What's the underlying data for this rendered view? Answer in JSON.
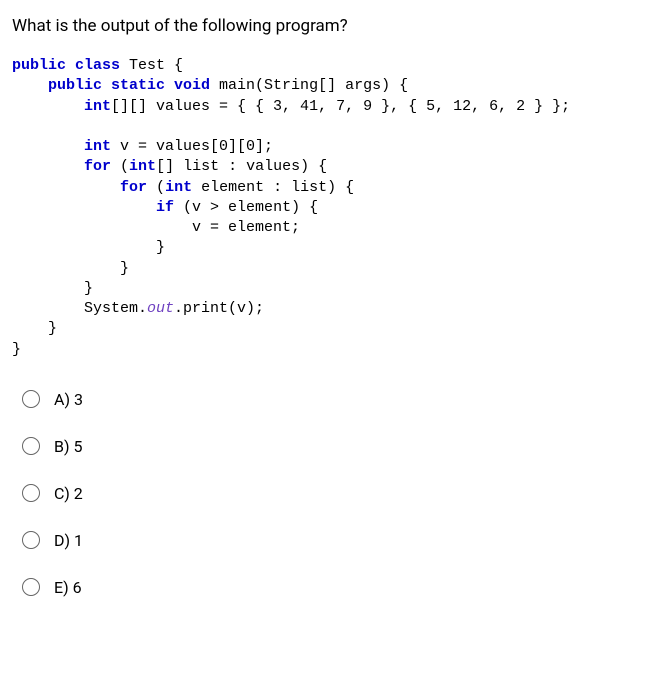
{
  "question": "What is the output of the following program?",
  "code": {
    "l1_kw1": "public class",
    "l1_cls": " Test {",
    "l2_kw1": "public static void",
    "l2_m": " main(String[] args) {",
    "l3_kw1": "int",
    "l3_rest": "[][] values = { { 3, 41, 7, 9 }, { 5, 12, 6, 2 } };",
    "l4_kw1": "int",
    "l4_rest": " v = values[0][0];",
    "l5_kw1": "for",
    "l5_a": " (",
    "l5_kw2": "int",
    "l5_b": "[] list : values) {",
    "l6_kw1": "for",
    "l6_a": " (",
    "l6_kw2": "int",
    "l6_b": " element : list) {",
    "l7_kw1": "if",
    "l7_rest": " (v > element) {",
    "l8": "v = element;",
    "l9": "}",
    "l10": "}",
    "l11": "}",
    "l12_a": "System.",
    "l12_out": "out",
    "l12_b": ".print(v);",
    "l13": "}",
    "l14": "}"
  },
  "options": {
    "a": "A) 3",
    "b": "B) 5",
    "c": "C) 2",
    "d": "D) 1",
    "e": "E) 6"
  }
}
